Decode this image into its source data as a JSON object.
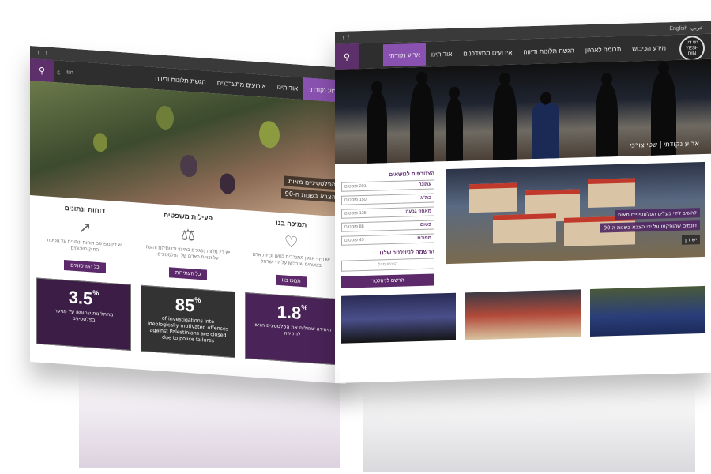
{
  "left_site": {
    "social": [
      "t",
      "f"
    ],
    "lang": [
      "En",
      "ع"
    ],
    "nav": [
      "ארוע נקודתי",
      "אודותינו",
      "אירועים מתעדכנים",
      "הגשת תלונות ודיווח"
    ],
    "hero_caption_lines": [
      "הפלסטיניים מאות",
      "הצבא בשנות ה-90"
    ],
    "columns": [
      {
        "title": "תמיכה בנו",
        "icon": "hand-heart-icon",
        "text": "יש דין - ארגון מתנדבים למען זכויות אדם בשטחים שנכבשו על ידי ישראל",
        "button": "תמכו בנו"
      },
      {
        "title": "פעילות משפטית",
        "icon": "scales-icon",
        "text": "יש דין מלווה נפגעים במיצוי זכויותיהם והגנה על זכויות האדם של הפלסטינים",
        "button": "כל העתירות"
      },
      {
        "title": "דוחות ונתונים",
        "icon": "chart-icon",
        "text": "יש דין מפרסם דוחות ונתונים על אכיפת החוק בשטחים",
        "button": "כל הפרסומים"
      }
    ],
    "stats": [
      {
        "value": "1.8",
        "unit": "%",
        "text": "היחידה שחולות את הפלסטינים הגישו לחקירה"
      },
      {
        "value": "85",
        "unit": "%",
        "text": "of investigations into ideologically motivated offenses against Palestinians are closed due to police failures"
      },
      {
        "value": "3.5",
        "unit": "%",
        "text": "מהתלונות שהוגשו על פגיעה בפלסטינים"
      }
    ]
  },
  "right_site": {
    "social": [
      "t",
      "f"
    ],
    "top_links": [
      "English",
      "عربي"
    ],
    "logo_text": "יש דין YESH DIN",
    "nav": [
      "ארוע נקודתי",
      "אודותינו",
      "אירועים מתעדכנים",
      "הגשת תלונות ודיווח",
      "תרומה לארגון",
      "מידע הכיבוש"
    ],
    "hero_caption": "ארוע נקודתי | שטי צורכי",
    "form_title": "הצטרפות לנושאים",
    "form_rows": [
      {
        "label": "עמונה",
        "count": "201 פוסטים"
      },
      {
        "label": "בת\"ג",
        "count": "150 פוסטים"
      },
      {
        "label": "מאחזי גבעה",
        "count": "135 פוסטים"
      },
      {
        "label": "פטום",
        "count": "88 פוסטים"
      },
      {
        "label": "מפוכס",
        "count": "45 פוסטים"
      }
    ],
    "newsletter_label": "הרשמה לניוזלטר שלנו",
    "email_placeholder": "הכנסו מייל",
    "subscribe_button": "הרשם לניוזלטר",
    "feature_caption_lines": [
      "להשיב לידי בעלים הפלסטיניים מאות",
      "דונמים שהופקעו על ידי הצבא בשנות ה-90"
    ],
    "feature_byline": "יש דין"
  },
  "colors": {
    "brand_purple": "#5c2a6b",
    "nav_dark": "#2e2e2e",
    "active_nav": "#8a52b0"
  }
}
